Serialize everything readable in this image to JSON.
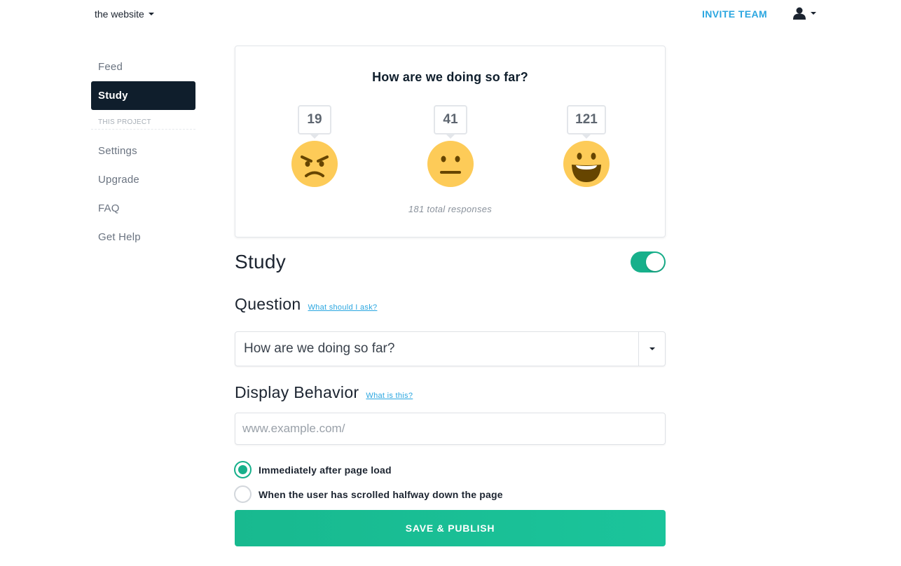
{
  "header": {
    "site_name": "the website",
    "invite_label": "INVITE TEAM"
  },
  "sidebar": {
    "items": [
      {
        "label": "Feed",
        "active": false
      },
      {
        "label": "Study",
        "active": true
      }
    ],
    "section_label": "THIS PROJECT",
    "project_items": [
      {
        "label": "Settings"
      },
      {
        "label": "Upgrade"
      },
      {
        "label": "FAQ"
      },
      {
        "label": "Get Help"
      }
    ]
  },
  "results": {
    "question": "How are we doing so far?",
    "ratings": [
      {
        "count": "19",
        "icon": "angry-face-icon"
      },
      {
        "count": "41",
        "icon": "neutral-face-icon"
      },
      {
        "count": "121",
        "icon": "grinning-face-icon"
      }
    ],
    "total_label": "181 total responses"
  },
  "form": {
    "title": "Study",
    "enabled": true,
    "question_heading": "Question",
    "question_help": "What should I ask?",
    "question_value": "How are we doing so far?",
    "display_heading": "Display Behavior",
    "display_help": "What is this?",
    "url_placeholder": "www.example.com/",
    "options": [
      {
        "label": "Immediately after page load",
        "checked": true
      },
      {
        "label": "When the user has scrolled halfway down the page",
        "checked": false
      }
    ],
    "save_label": "SAVE & PUBLISH"
  },
  "colors": {
    "accent": "#17b08b",
    "link": "#2aa6e0",
    "nav_active_bg": "#0f1e2c",
    "emoji_yellow": "#fdcb58"
  }
}
